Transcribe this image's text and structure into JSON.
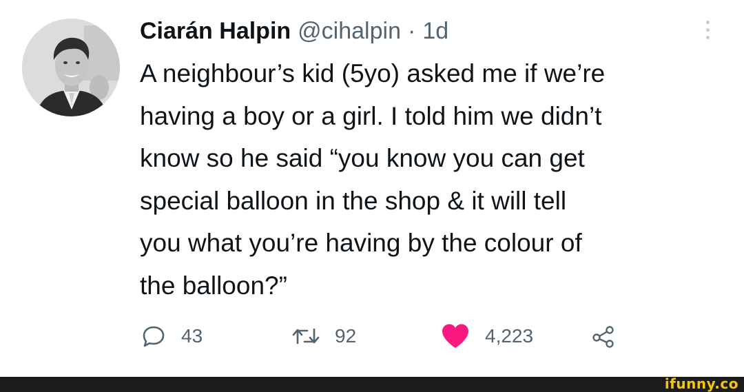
{
  "tweet": {
    "display_name": "Ciarán Halpin",
    "handle": "@cihalpin",
    "separator": "·",
    "time": "1d",
    "lines": [
      "A neighbour’s kid (5yo) asked me if we’re",
      "having a boy or a girl. I told him we didn’t",
      "know so he said “you know you can get",
      "special balloon in the shop & it will tell",
      "you what you’re having by the colour of",
      "the balloon?”"
    ]
  },
  "actions": {
    "reply_count": "43",
    "retweet_count": "92",
    "like_count": "4,223",
    "icons": [
      "reply-icon",
      "retweet-icon",
      "heart-icon",
      "share-icon"
    ],
    "like_color": "#f91880"
  },
  "watermark": {
    "text": "ifunny.co",
    "color": "#f8c600"
  }
}
